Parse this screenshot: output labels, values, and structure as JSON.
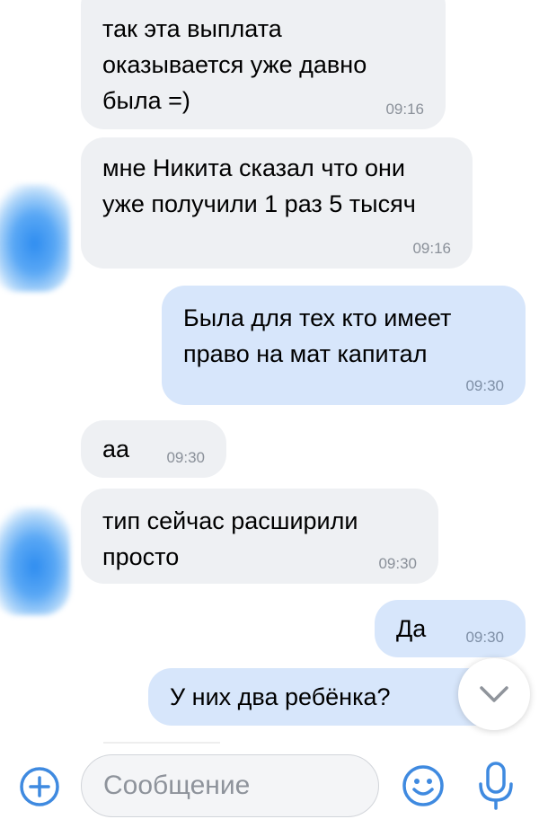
{
  "chat": {
    "messages": [
      {
        "direction": "incoming",
        "text": "так эта выплата оказывается уже давно была =)",
        "time": "09:16"
      },
      {
        "direction": "incoming",
        "text": "мне Никита сказал что они уже получили 1 раз 5 тысяч",
        "time": "09:16"
      },
      {
        "direction": "outgoing",
        "text": "Была для тех кто имеет право на мат капитал",
        "time": "09:30"
      },
      {
        "direction": "incoming",
        "text": "аа",
        "time": "09:30"
      },
      {
        "direction": "incoming",
        "text": "тип сейчас расширили просто",
        "time": "09:30"
      },
      {
        "direction": "outgoing",
        "text": "Да",
        "time": "09:30"
      },
      {
        "direction": "outgoing",
        "text": "У них два ребёнка?",
        "time": ""
      }
    ]
  },
  "composer": {
    "placeholder": "Сообщение"
  },
  "icons": {
    "attach": "plus-circle-icon",
    "emoji": "smiley-icon",
    "voice": "microphone-icon",
    "scroll": "chevron-down-icon"
  },
  "colors": {
    "accent": "#3f8ae0",
    "incoming_bubble": "#eef0f3",
    "outgoing_bubble": "#d7e6fb"
  }
}
